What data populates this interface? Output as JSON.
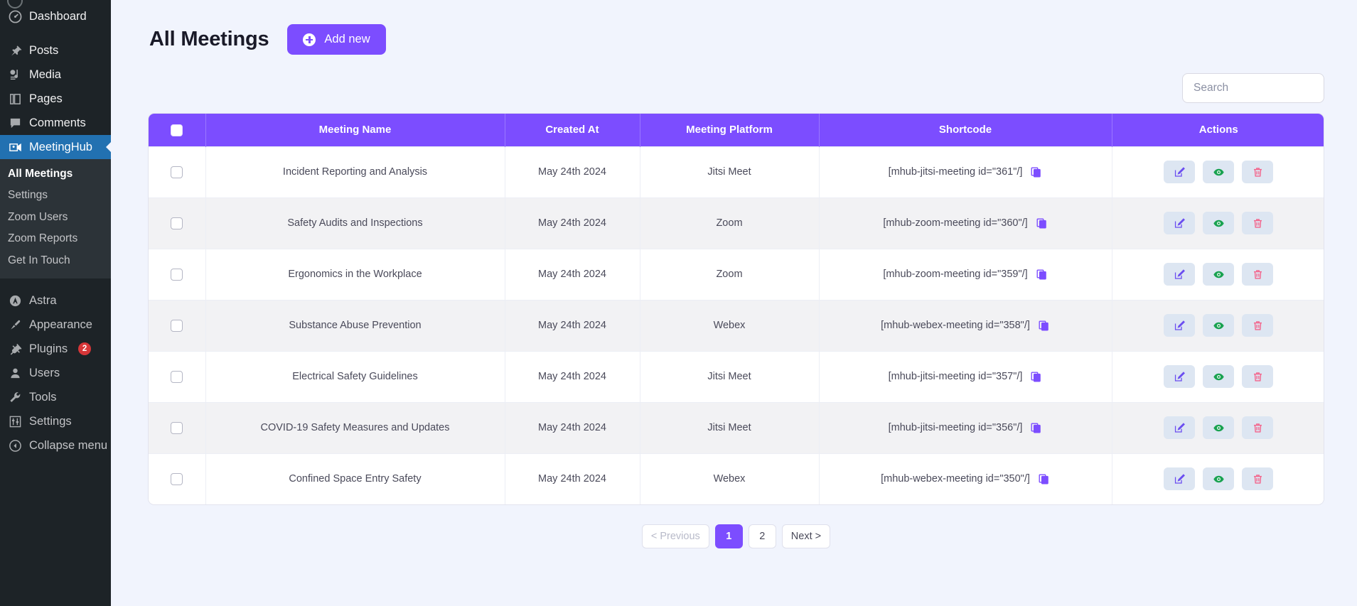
{
  "sidebar": {
    "items": [
      {
        "label": "Dashboard",
        "icon": "dashboard-icon",
        "active": false
      },
      {
        "label": "Posts",
        "icon": "pin-icon",
        "active": false
      },
      {
        "label": "Media",
        "icon": "media-icon",
        "active": false
      },
      {
        "label": "Pages",
        "icon": "pages-icon",
        "active": false
      },
      {
        "label": "Comments",
        "icon": "comment-icon",
        "active": false
      },
      {
        "label": "MeetingHub",
        "icon": "meetinghub-icon",
        "active": true
      }
    ],
    "submenu": [
      {
        "label": "All Meetings",
        "current": true
      },
      {
        "label": "Settings",
        "current": false
      },
      {
        "label": "Zoom Users",
        "current": false
      },
      {
        "label": "Zoom Reports",
        "current": false
      },
      {
        "label": "Get In Touch",
        "current": false
      }
    ],
    "items_bottom": [
      {
        "label": "Astra",
        "icon": "astra-icon",
        "badge": ""
      },
      {
        "label": "Appearance",
        "icon": "brush-icon",
        "badge": ""
      },
      {
        "label": "Plugins",
        "icon": "plug-icon",
        "badge": "2"
      },
      {
        "label": "Users",
        "icon": "user-icon",
        "badge": ""
      },
      {
        "label": "Tools",
        "icon": "wrench-icon",
        "badge": ""
      },
      {
        "label": "Settings",
        "icon": "sliders-icon",
        "badge": ""
      },
      {
        "label": "Collapse menu",
        "icon": "collapse-icon",
        "badge": ""
      }
    ]
  },
  "header": {
    "title": "All Meetings",
    "add_new_label": "Add new"
  },
  "search": {
    "placeholder": "Search",
    "value": ""
  },
  "table": {
    "columns": [
      "",
      "Meeting Name",
      "Created At",
      "Meeting Platform",
      "Shortcode",
      "Actions"
    ],
    "rows": [
      {
        "name": "Incident Reporting and Analysis",
        "created_at": "May 24th 2024",
        "platform": "Jitsi Meet",
        "shortcode": "[mhub-jitsi-meeting id=\"361\"/]"
      },
      {
        "name": "Safety Audits and Inspections",
        "created_at": "May 24th 2024",
        "platform": "Zoom",
        "shortcode": "[mhub-zoom-meeting id=\"360\"/]"
      },
      {
        "name": "Ergonomics in the Workplace",
        "created_at": "May 24th 2024",
        "platform": "Zoom",
        "shortcode": "[mhub-zoom-meeting id=\"359\"/]"
      },
      {
        "name": "Substance Abuse Prevention",
        "created_at": "May 24th 2024",
        "platform": "Webex",
        "shortcode": "[mhub-webex-meeting id=\"358\"/]"
      },
      {
        "name": "Electrical Safety Guidelines",
        "created_at": "May 24th 2024",
        "platform": "Jitsi Meet",
        "shortcode": "[mhub-jitsi-meeting id=\"357\"/]"
      },
      {
        "name": "COVID-19 Safety Measures and Updates",
        "created_at": "May 24th 2024",
        "platform": "Jitsi Meet",
        "shortcode": "[mhub-jitsi-meeting id=\"356\"/]"
      },
      {
        "name": "Confined Space Entry Safety",
        "created_at": "May 24th 2024",
        "platform": "Webex",
        "shortcode": "[mhub-webex-meeting id=\"350\"/]"
      }
    ]
  },
  "pagination": {
    "previous_label": "< Previous",
    "pages": [
      "1",
      "2"
    ],
    "current_page": "1",
    "next_label": "Next >"
  },
  "colors": {
    "accent": "#7c4dff",
    "sidebar_bg": "#1d2327",
    "sidebar_active": "#2271b1",
    "page_bg": "#f1f4fd",
    "badge": "#d63638",
    "edit_icon": "#6b4ef0",
    "view_icon": "#1aa251",
    "delete_icon": "#f4628a"
  }
}
